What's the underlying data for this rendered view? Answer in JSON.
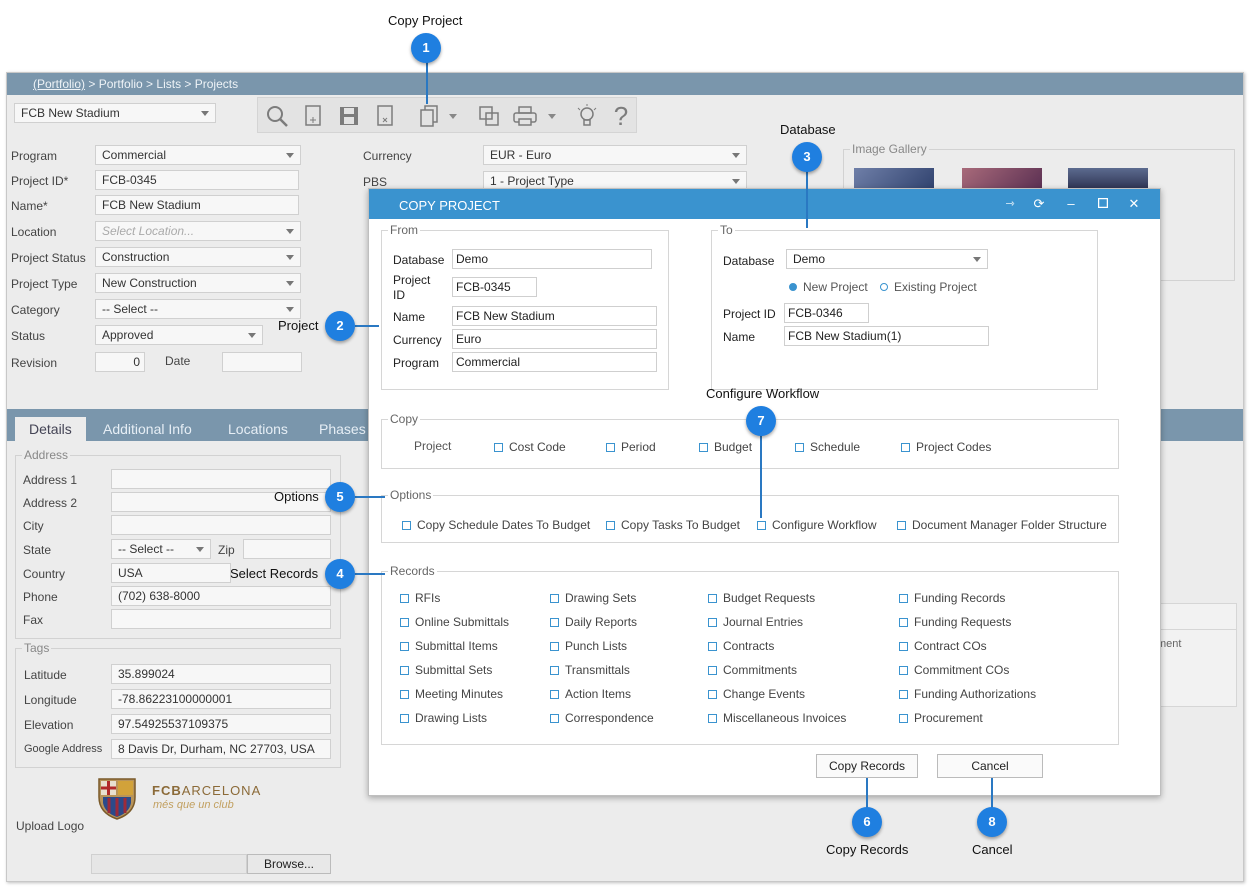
{
  "callouts": {
    "copy_project": "Copy Project",
    "database": "Database",
    "project": "Project",
    "configure_workflow": "Configure Workflow",
    "options": "Options",
    "select_records": "Select Records",
    "copy_records": "Copy Records",
    "cancel": "Cancel",
    "n1": "1",
    "n2": "2",
    "n3": "3",
    "n4": "4",
    "n5": "5",
    "n6": "6",
    "n7": "7",
    "n8": "8"
  },
  "breadcrumb": {
    "root": "(Portfolio)",
    "rest": " > Portfolio > Lists > Projects"
  },
  "project_selector": "FCB New Stadium",
  "form": {
    "program_label": "Program",
    "program": "Commercial",
    "project_id_label": "Project ID*",
    "project_id": "FCB-0345",
    "name_label": "Name*",
    "name": "FCB New Stadium",
    "location_label": "Location",
    "location_placeholder": "Select Location...",
    "status_label": "Project Status",
    "status": "Construction",
    "type_label": "Project Type",
    "type": "New Construction",
    "category_label": "Category",
    "category": "-- Select --",
    "approval_label": "Status",
    "approval": "Approved",
    "revision_label": "Revision",
    "revision": "0",
    "date_label": "Date",
    "currency_label": "Currency",
    "currency": "EUR - Euro",
    "pbs_label": "PBS",
    "pbs": "1 - Project Type",
    "gallery_label": "Image Gallery"
  },
  "tabs": [
    "Details",
    "Additional Info",
    "Locations",
    "Phases"
  ],
  "address": {
    "title": "Address",
    "address1_label": "Address 1",
    "address2_label": "Address 2",
    "city_label": "City",
    "state_label": "State",
    "state": "-- Select --",
    "zip_label": "Zip",
    "country_label": "Country",
    "country": "USA",
    "phone_label": "Phone",
    "phone": "(702) 638-8000",
    "fax_label": "Fax"
  },
  "tags": {
    "title": "Tags",
    "latitude_label": "Latitude",
    "latitude": "35.899024",
    "longitude_label": "Longitude",
    "longitude": "-78.86223100000001",
    "elevation_label": "Elevation",
    "elevation": "97.54925537109375",
    "google_label": "Google Address",
    "google": "8 Davis Dr, Durham, NC 27703, USA"
  },
  "logo": {
    "name_bold": "FCB",
    "name_rest": "ARCELONA",
    "tagline": "més que un club"
  },
  "upload_logo": "Upload Logo",
  "browse": "Browse...",
  "right_panel_fragment": "ment",
  "dialog": {
    "title": "COPY PROJECT",
    "from": {
      "legend": "From",
      "database_label": "Database",
      "database": "Demo",
      "project_id_label": "Project ID",
      "project_id": "FCB-0345",
      "name_label": "Name",
      "name": "FCB New Stadium",
      "currency_label": "Currency",
      "currency": "Euro",
      "program_label": "Program",
      "program": "Commercial"
    },
    "to": {
      "legend": "To",
      "database_label": "Database",
      "database": "Demo",
      "new_project": "New Project",
      "existing_project": "Existing Project",
      "project_id_label": "Project ID",
      "project_id": "FCB-0346",
      "name_label": "Name",
      "name": "FCB New Stadium(1)"
    },
    "copy": {
      "legend": "Copy",
      "project": "Project",
      "items": [
        "Cost Code",
        "Period",
        "Budget",
        "Schedule",
        "Project Codes"
      ]
    },
    "options": {
      "legend": "Options",
      "items": [
        "Copy Schedule Dates To Budget",
        "Copy Tasks To Budget",
        "Configure Workflow",
        "Document Manager Folder Structure"
      ]
    },
    "records": {
      "legend": "Records",
      "col1": [
        "RFIs",
        "Online Submittals",
        "Submittal Items",
        "Submittal Sets",
        "Meeting Minutes",
        "Drawing Lists"
      ],
      "col2": [
        "Drawing Sets",
        "Daily Reports",
        "Punch Lists",
        "Transmittals",
        "Action Items",
        "Correspondence"
      ],
      "col3": [
        "Budget Requests",
        "Journal Entries",
        "Contracts",
        "Commitments",
        "Change Events",
        "Miscellaneous Invoices"
      ],
      "col4": [
        "Funding Records",
        "Funding Requests",
        "Contract COs",
        "Commitment COs",
        "Funding Authorizations",
        "Procurement"
      ]
    },
    "copy_records_btn": "Copy Records",
    "cancel_btn": "Cancel"
  },
  "colors": {
    "accent": "#3a93cf",
    "badge": "#1f7fe0",
    "header": "#7a96ac"
  }
}
